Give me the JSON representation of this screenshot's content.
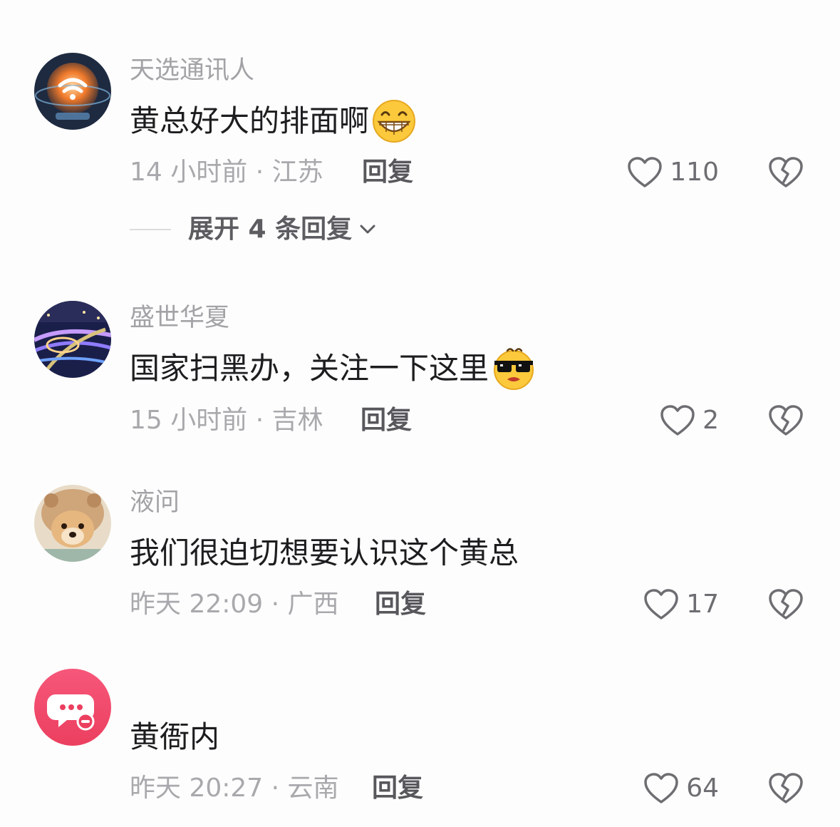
{
  "comments": [
    {
      "username": "天选通讯人",
      "text": "黄总好大的排面啊",
      "emoji": "grinning-face",
      "time_location": "14 小时前 · 江苏",
      "reply_label": "回复",
      "likes": "110",
      "expand_label": "展开 4 条回复"
    },
    {
      "username": "盛世华夏",
      "text": "国家扫黑办，关注一下这里",
      "emoji": "sunglasses-face",
      "time_location": "15 小时前 · 吉林",
      "reply_label": "回复",
      "likes": "2"
    },
    {
      "username": "液问",
      "text": "我们很迫切想要认识这个黄总",
      "time_location": "昨天 22:09 · 广西",
      "reply_label": "回复",
      "likes": "17"
    },
    {
      "username": "",
      "text": "黄衙内",
      "time_location": "昨天 20:27 · 云南",
      "reply_label": "回复",
      "likes": "64"
    }
  ],
  "icons": {
    "like": "heart-outline-icon",
    "dislike": "broken-heart-icon",
    "expand": "chevron-down-icon"
  },
  "colors": {
    "username": "#a3a3a7",
    "text": "#1d1d1f",
    "meta": "#a9a9ad",
    "avatar4_bg": "#ef4a6b"
  }
}
